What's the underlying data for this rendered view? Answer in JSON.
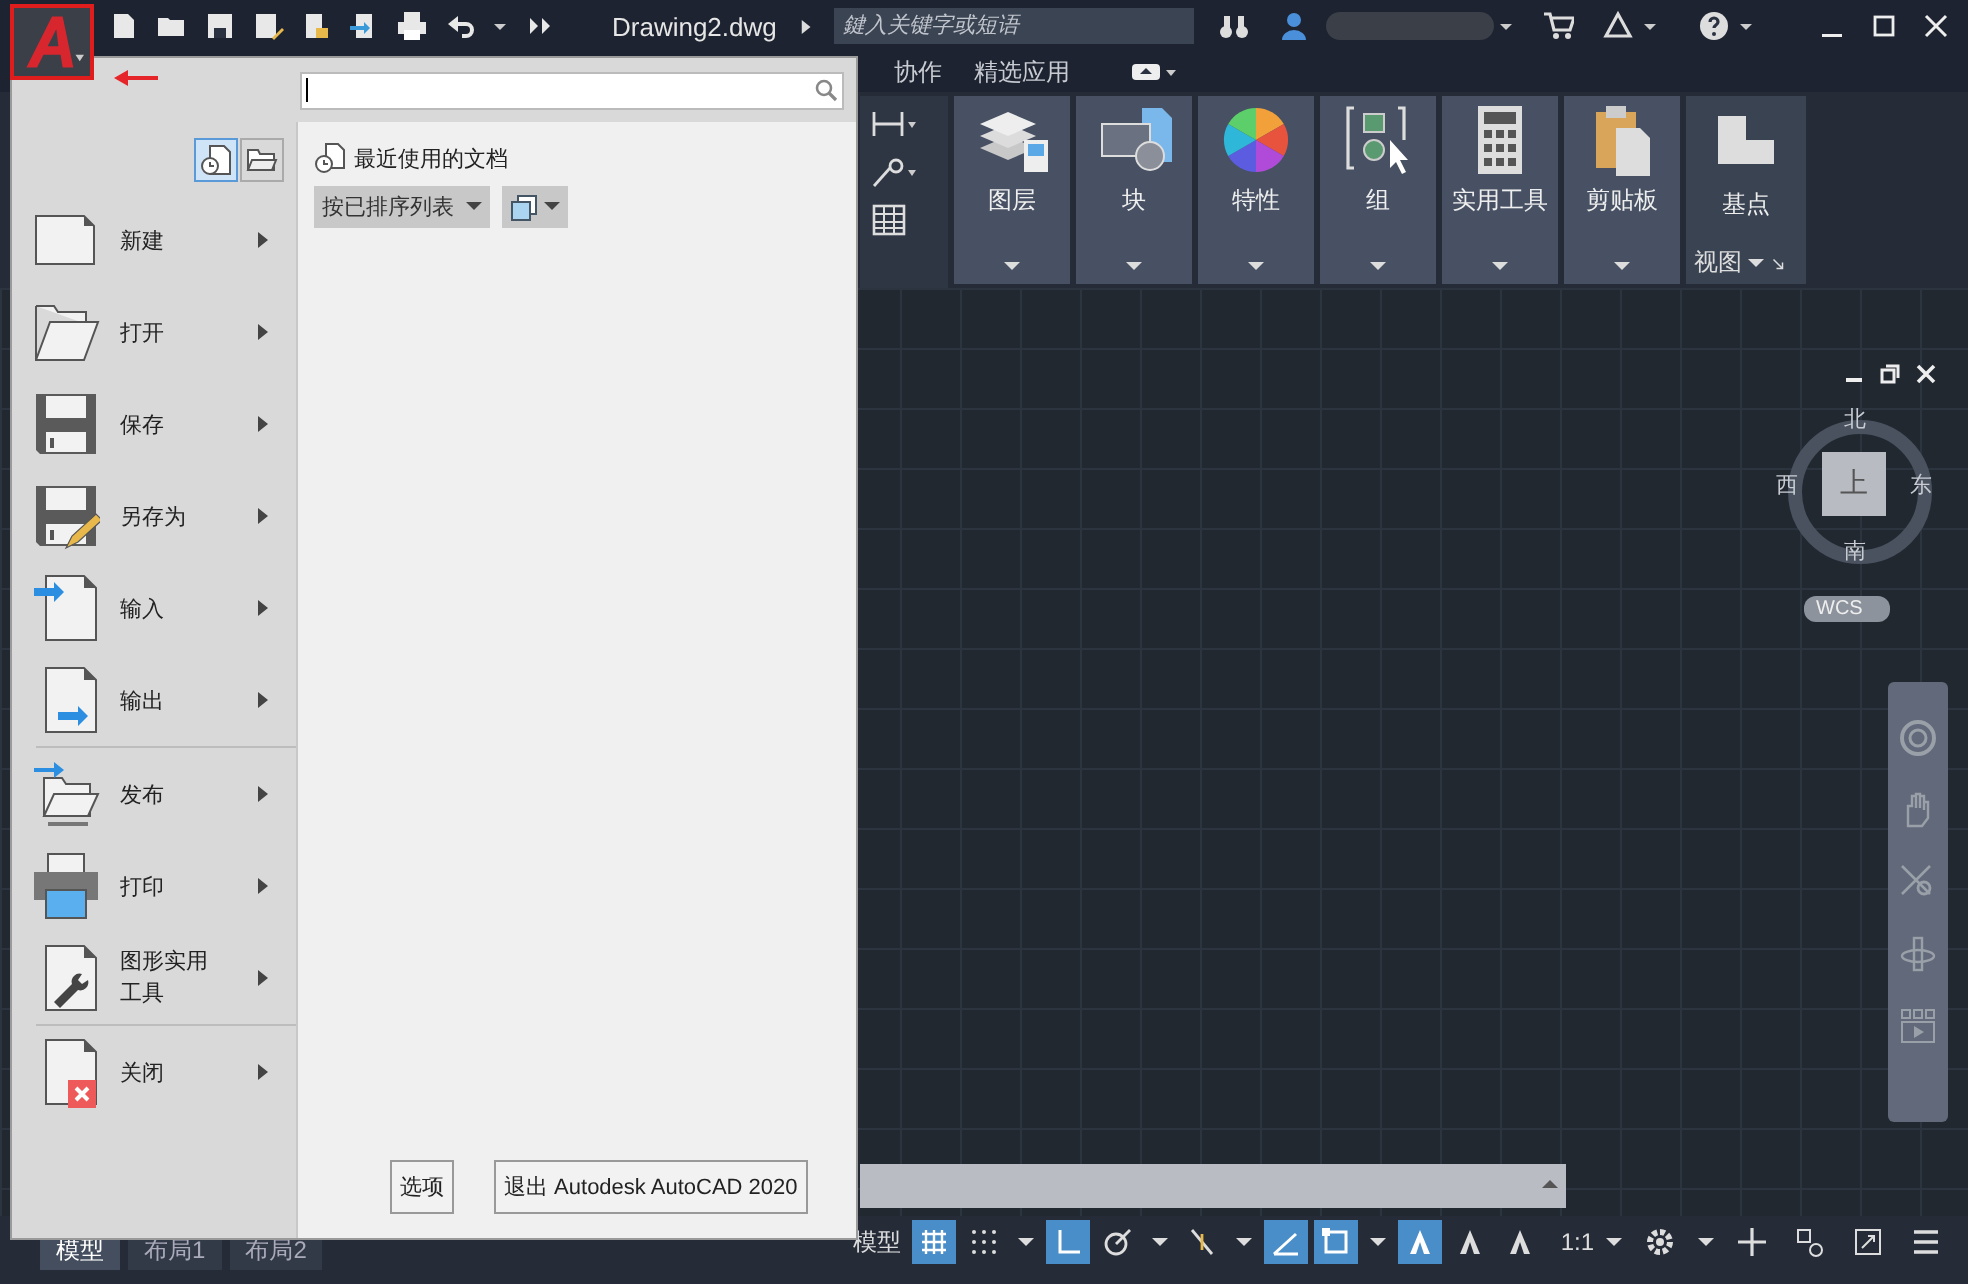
{
  "title_bar": {
    "file_name": "Drawing2.dwg",
    "search": {
      "placeholder": "鍵入关键字或短语"
    }
  },
  "ribbon": {
    "tabs": [
      {
        "label": "协作",
        "selected": false
      },
      {
        "label": "精选应用",
        "selected": false
      }
    ],
    "panels": [
      {
        "label": "图层",
        "kind": "layers"
      },
      {
        "label": "块",
        "kind": "block"
      },
      {
        "label": "特性",
        "kind": "properties"
      },
      {
        "label": "组",
        "kind": "group"
      },
      {
        "label": "实用工具",
        "kind": "calculator"
      },
      {
        "label": "剪贴板",
        "kind": "clipboard"
      }
    ],
    "view_panel": {
      "button": "基点",
      "title": "视图"
    }
  },
  "app_menu": {
    "view_toggle": [
      {
        "kind": "recent",
        "selected": true
      },
      {
        "kind": "open",
        "selected": false
      }
    ],
    "items": [
      {
        "label": "新建",
        "kind": "new",
        "separator_before": false
      },
      {
        "label": "打开",
        "kind": "open",
        "separator_before": false
      },
      {
        "label": "保存",
        "kind": "save",
        "separator_before": false
      },
      {
        "label": "另存为",
        "kind": "saveas",
        "separator_before": false
      },
      {
        "label": "输入",
        "kind": "import",
        "separator_before": false
      },
      {
        "label": "输出",
        "kind": "export",
        "separator_before": false
      },
      {
        "label": "发布",
        "kind": "publish",
        "separator_before": true
      },
      {
        "label": "打印",
        "kind": "print",
        "separator_before": false
      },
      {
        "label": "图形实用工具",
        "kind": "utilities",
        "separator_before": false
      },
      {
        "label": "关闭",
        "kind": "close",
        "separator_before": true
      }
    ],
    "recent": {
      "title": "最近使用的文档",
      "sort": "按已排序列表"
    },
    "buttons": [
      {
        "label": "选项"
      },
      {
        "label": "退出 Autodesk AutoCAD 2020"
      }
    ]
  },
  "viewcube": {
    "north": "北",
    "west": "西",
    "east": "东",
    "south": "南",
    "face": "上",
    "ucs": "WCS"
  },
  "layout_tabs": [
    {
      "label": "模型",
      "selected": true
    },
    {
      "label": "布局1",
      "selected": false
    },
    {
      "label": "布局2",
      "selected": false
    }
  ],
  "status_bar": {
    "space": "模型",
    "scale": "1:1",
    "toggles": [
      {
        "kind": "grid",
        "on": true
      },
      {
        "kind": "snap",
        "on": false
      },
      {
        "kind": "ortho",
        "on": true
      },
      {
        "kind": "polar",
        "on": false
      },
      {
        "kind": "osnap",
        "on": false
      },
      {
        "kind": "angle",
        "on": true
      },
      {
        "kind": "rect",
        "on": true
      },
      {
        "kind": "anno",
        "on": true
      },
      {
        "kind": "anno",
        "on": false
      },
      {
        "kind": "anno",
        "on": false
      }
    ]
  }
}
